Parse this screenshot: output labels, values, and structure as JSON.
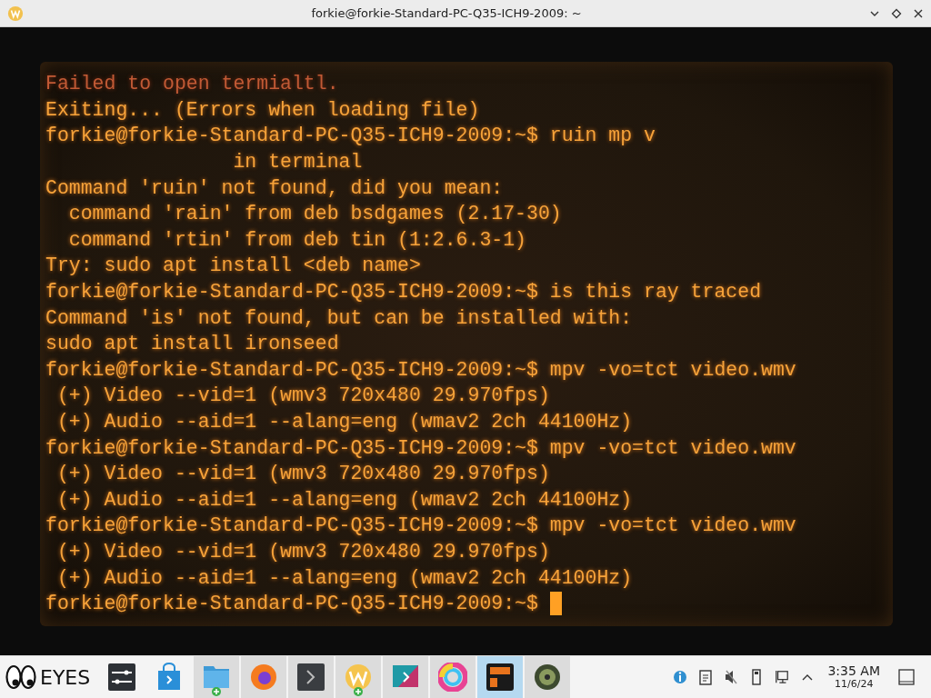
{
  "window": {
    "title": "forkie@forkie-Standard-PC-Q35-ICH9-2009: ~"
  },
  "terminal": {
    "lines": [
      {
        "kind": "error",
        "text": "Failed to open termialtl."
      },
      {
        "kind": "output",
        "text": "Exiting... (Errors when loading file)"
      },
      {
        "kind": "output",
        "text": "forkie@forkie-Standard-PC-Q35-ICH9-2009:~$ ruin mp v"
      },
      {
        "kind": "output",
        "text": "                in terminal"
      },
      {
        "kind": "output",
        "text": "Command 'ruin' not found, did you mean:"
      },
      {
        "kind": "output",
        "text": "  command 'rain' from deb bsdgames (2.17-30)"
      },
      {
        "kind": "output",
        "text": "  command 'rtin' from deb tin (1:2.6.3-1)"
      },
      {
        "kind": "output",
        "text": "Try: sudo apt install <deb name>"
      },
      {
        "kind": "output",
        "text": "forkie@forkie-Standard-PC-Q35-ICH9-2009:~$ is this ray traced"
      },
      {
        "kind": "output",
        "text": "Command 'is' not found, but can be installed with:"
      },
      {
        "kind": "output",
        "text": "sudo apt install ironseed"
      },
      {
        "kind": "output",
        "text": "forkie@forkie-Standard-PC-Q35-ICH9-2009:~$ mpv -vo=tct video.wmv"
      },
      {
        "kind": "output",
        "text": " (+) Video --vid=1 (wmv3 720x480 29.970fps)"
      },
      {
        "kind": "output",
        "text": " (+) Audio --aid=1 --alang=eng (wmav2 2ch 44100Hz)"
      },
      {
        "kind": "output",
        "text": "forkie@forkie-Standard-PC-Q35-ICH9-2009:~$ mpv -vo=tct video.wmv"
      },
      {
        "kind": "output",
        "text": " (+) Video --vid=1 (wmv3 720x480 29.970fps)"
      },
      {
        "kind": "output",
        "text": " (+) Audio --aid=1 --alang=eng (wmav2 2ch 44100Hz)"
      },
      {
        "kind": "output",
        "text": "forkie@forkie-Standard-PC-Q35-ICH9-2009:~$ mpv -vo=tct video.wmv"
      },
      {
        "kind": "output",
        "text": " (+) Video --vid=1 (wmv3 720x480 29.970fps)"
      },
      {
        "kind": "output",
        "text": " (+) Audio --aid=1 --alang=eng (wmav2 2ch 44100Hz)"
      },
      {
        "kind": "prompt",
        "text": "forkie@forkie-Standard-PC-Q35-ICH9-2009:~$ "
      }
    ]
  },
  "taskbar": {
    "start_label": "EYES",
    "items": [
      {
        "kind": "mixer",
        "running": false,
        "selected": false,
        "badge": false
      },
      {
        "kind": "store",
        "running": false,
        "selected": false,
        "badge": false
      },
      {
        "kind": "folder",
        "running": true,
        "selected": false,
        "badge": true
      },
      {
        "kind": "browser",
        "running": true,
        "selected": false,
        "badge": false
      },
      {
        "kind": "terminal",
        "running": true,
        "selected": false,
        "badge": false
      },
      {
        "kind": "w",
        "running": true,
        "selected": false,
        "badge": true
      },
      {
        "kind": "paint",
        "running": true,
        "selected": false,
        "badge": false
      },
      {
        "kind": "swirl",
        "running": true,
        "selected": false,
        "badge": false
      },
      {
        "kind": "crt",
        "running": true,
        "selected": true,
        "badge": false
      },
      {
        "kind": "disc",
        "running": true,
        "selected": false,
        "badge": false
      }
    ],
    "time": "3:35 AM",
    "date": "11/6/24"
  }
}
